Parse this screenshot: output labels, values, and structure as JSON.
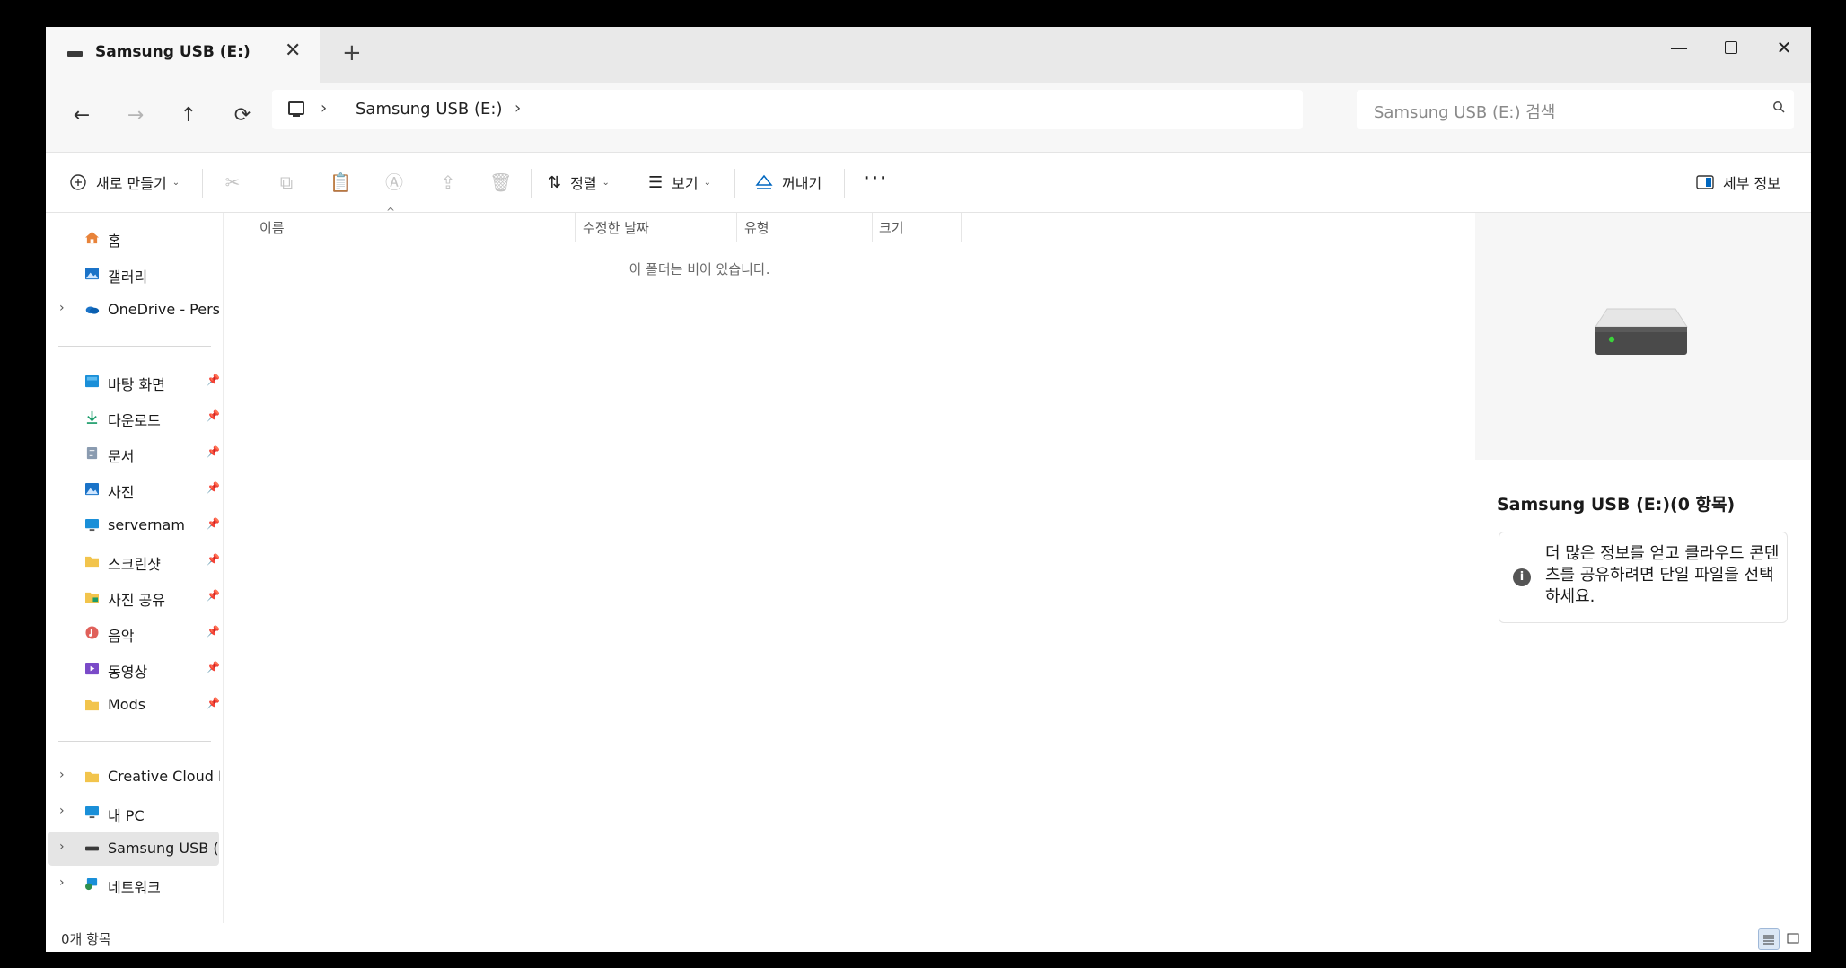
{
  "tab": {
    "title": "Samsung USB (E:)",
    "close": "✕",
    "new_tab": "+"
  },
  "window_controls": {
    "minimize": "—",
    "close": "✕"
  },
  "address": {
    "crumbs": [
      "Samsung USB (E:)"
    ],
    "separator": "›",
    "search_placeholder": "Samsung USB (E:) 검색"
  },
  "nav": {
    "back": "←",
    "forward": "→",
    "up": "↑",
    "refresh": "⟳"
  },
  "toolbar": {
    "new": "새로 만들기",
    "sort": "정렬",
    "view": "보기",
    "eject": "꺼내기",
    "more": "···",
    "details": "세부 정보"
  },
  "sidebar": {
    "top": [
      {
        "label": "홈",
        "icon": "home-icon"
      },
      {
        "label": "갤러리",
        "icon": "gallery-icon"
      },
      {
        "label": "OneDrive - Person",
        "icon": "onedrive-icon"
      }
    ],
    "pinned": [
      {
        "label": "바탕 화면",
        "icon": "desktop-icon"
      },
      {
        "label": "다운로드",
        "icon": "download-icon"
      },
      {
        "label": "문서",
        "icon": "document-icon"
      },
      {
        "label": "사진",
        "icon": "pictures-icon"
      },
      {
        "label": "servernam",
        "icon": "monitor-icon"
      },
      {
        "label": "스크린샷",
        "icon": "folder-icon"
      },
      {
        "label": "사진 공유",
        "icon": "folder-icon"
      },
      {
        "label": "음악",
        "icon": "music-icon"
      },
      {
        "label": "동영상",
        "icon": "video-icon"
      },
      {
        "label": "Mods",
        "icon": "folder-icon"
      }
    ],
    "bottom": [
      {
        "label": "Creative Cloud File",
        "icon": "folder-icon"
      },
      {
        "label": "내 PC",
        "icon": "pc-icon"
      },
      {
        "label": "Samsung USB (E:)",
        "icon": "usb-drive-icon",
        "selected": true
      },
      {
        "label": "네트워크",
        "icon": "network-icon"
      }
    ]
  },
  "columns": [
    "이름",
    "수정한 날짜",
    "유형",
    "크기"
  ],
  "empty_message": "이 폴더는 비어 있습니다.",
  "details_pane": {
    "title": "Samsung USB (E:)(0 항목)",
    "info": "더 많은 정보를 얻고 클라우드 콘텐츠를 공유하려면 단일 파일을 선택하세요."
  },
  "status": {
    "count": "0개 항목"
  },
  "colors": {
    "accent": "#0067c0",
    "selection": "#e5e5e5"
  }
}
